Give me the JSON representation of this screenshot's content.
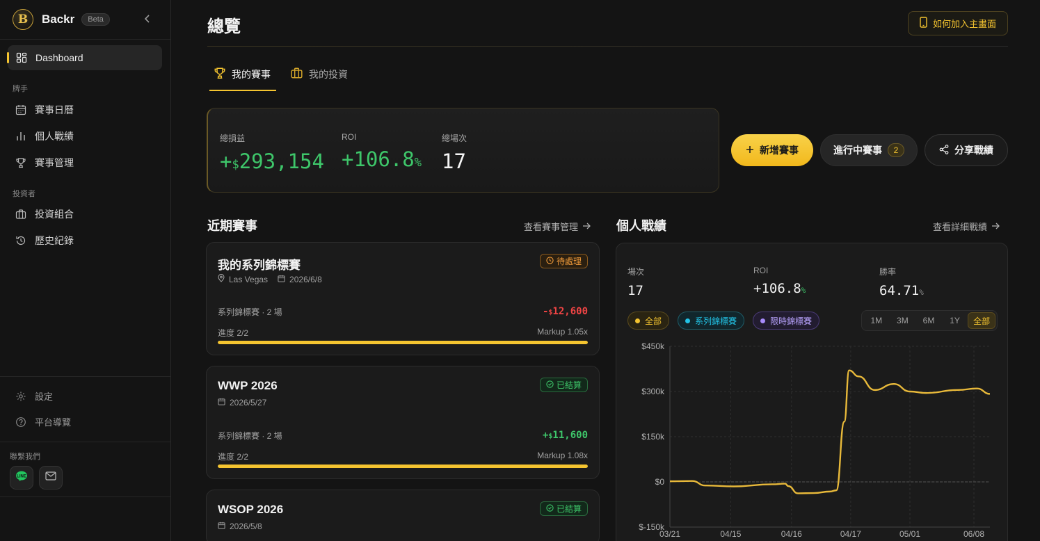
{
  "brand": {
    "name": "Backr",
    "badge": "Beta"
  },
  "sidebar": {
    "active_item": "Dashboard",
    "sections": [
      {
        "title": "牌手",
        "items": [
          {
            "label": "賽事日曆"
          },
          {
            "label": "個人戰績"
          },
          {
            "label": "賽事管理"
          }
        ]
      },
      {
        "title": "投資者",
        "items": [
          {
            "label": "投資組合"
          },
          {
            "label": "歷史紀錄"
          }
        ]
      }
    ],
    "footer": [
      {
        "label": "設定"
      },
      {
        "label": "平台導覽"
      }
    ],
    "contact_title": "聯繫我們"
  },
  "header": {
    "title": "總覽",
    "homescreen_button": "如何加入主畫面"
  },
  "tabs": [
    {
      "label": "我的賽事",
      "active": true
    },
    {
      "label": "我的投資",
      "active": false
    }
  ],
  "summary": {
    "profit": {
      "label": "總損益",
      "sign": "+",
      "currency": "$",
      "value": "293,154"
    },
    "roi": {
      "label": "ROI",
      "value": "+106.8",
      "unit": "%"
    },
    "events": {
      "label": "總場次",
      "value": "17"
    }
  },
  "actions": {
    "new": "新增賽事",
    "live": "進行中賽事",
    "live_count": "2",
    "share": "分享戰績"
  },
  "recent": {
    "title": "近期賽事",
    "link": "查看賽事管理",
    "cards": [
      {
        "title": "我的系列錦標賽",
        "location": "Las Vegas",
        "date": "2026/6/8",
        "status": "待處理",
        "status_type": "pending",
        "sub": "系列錦標賽 · 2 場",
        "amount_sign": "-",
        "amount_currency": "$",
        "amount": "12,600",
        "progress": "進度 2/2",
        "progress_fraction": 1.0,
        "markup": "Markup 1.05x"
      },
      {
        "title": "WWP 2026",
        "date": "2026/5/27",
        "status": "已結算",
        "status_type": "done",
        "sub": "系列錦標賽 · 2 場",
        "amount_sign": "+",
        "amount_currency": "$",
        "amount": "11,600",
        "progress": "進度 2/2",
        "progress_fraction": 1.0,
        "markup": "Markup 1.08x"
      },
      {
        "title": "WSOP 2026",
        "date": "2026/5/8",
        "status": "已結算",
        "status_type": "done"
      }
    ]
  },
  "performance": {
    "title": "個人戰績",
    "link": "查看詳細戰績",
    "stats": [
      {
        "label": "場次",
        "value": "17"
      },
      {
        "label": "ROI",
        "value": "+106.8",
        "unit": "%"
      },
      {
        "label": "勝率",
        "value": "64.71",
        "unit": "%"
      }
    ],
    "filters": [
      {
        "label": "全部",
        "color": "#f4c430"
      },
      {
        "label": "系列錦標賽",
        "color": "#22c3e6"
      },
      {
        "label": "限時錦標賽",
        "color": "#a78bfa"
      }
    ],
    "ranges": [
      "1M",
      "3M",
      "6M",
      "1Y",
      "全部"
    ],
    "active_range": "全部"
  },
  "chart_data": {
    "type": "line",
    "x_ticks": [
      "03/21",
      "04/15",
      "04/16",
      "04/17",
      "05/01",
      "06/08"
    ],
    "y_ticks": [
      "$450k",
      "$300k",
      "$150k",
      "$0",
      "$-150k"
    ],
    "ylim": [
      -150000,
      450000
    ],
    "grid": true,
    "line_color": "#e8b93a",
    "series": [
      {
        "values": [
          [
            0,
            2000
          ],
          [
            0.07,
            3000
          ],
          [
            0.11,
            -12000
          ],
          [
            0.2,
            -15000
          ],
          [
            0.32,
            -8000
          ],
          [
            0.36,
            -6000
          ],
          [
            0.37,
            -14000
          ],
          [
            0.4,
            -38000
          ],
          [
            0.45,
            -37000
          ],
          [
            0.5,
            -32000
          ],
          [
            0.52,
            -28000
          ],
          [
            0.545,
            200000
          ],
          [
            0.56,
            370000
          ],
          [
            0.59,
            350000
          ],
          [
            0.64,
            305000
          ],
          [
            0.7,
            325000
          ],
          [
            0.75,
            300000
          ],
          [
            0.8,
            295000
          ],
          [
            0.9,
            305000
          ],
          [
            0.96,
            310000
          ],
          [
            1.0,
            292000
          ]
        ]
      }
    ]
  }
}
